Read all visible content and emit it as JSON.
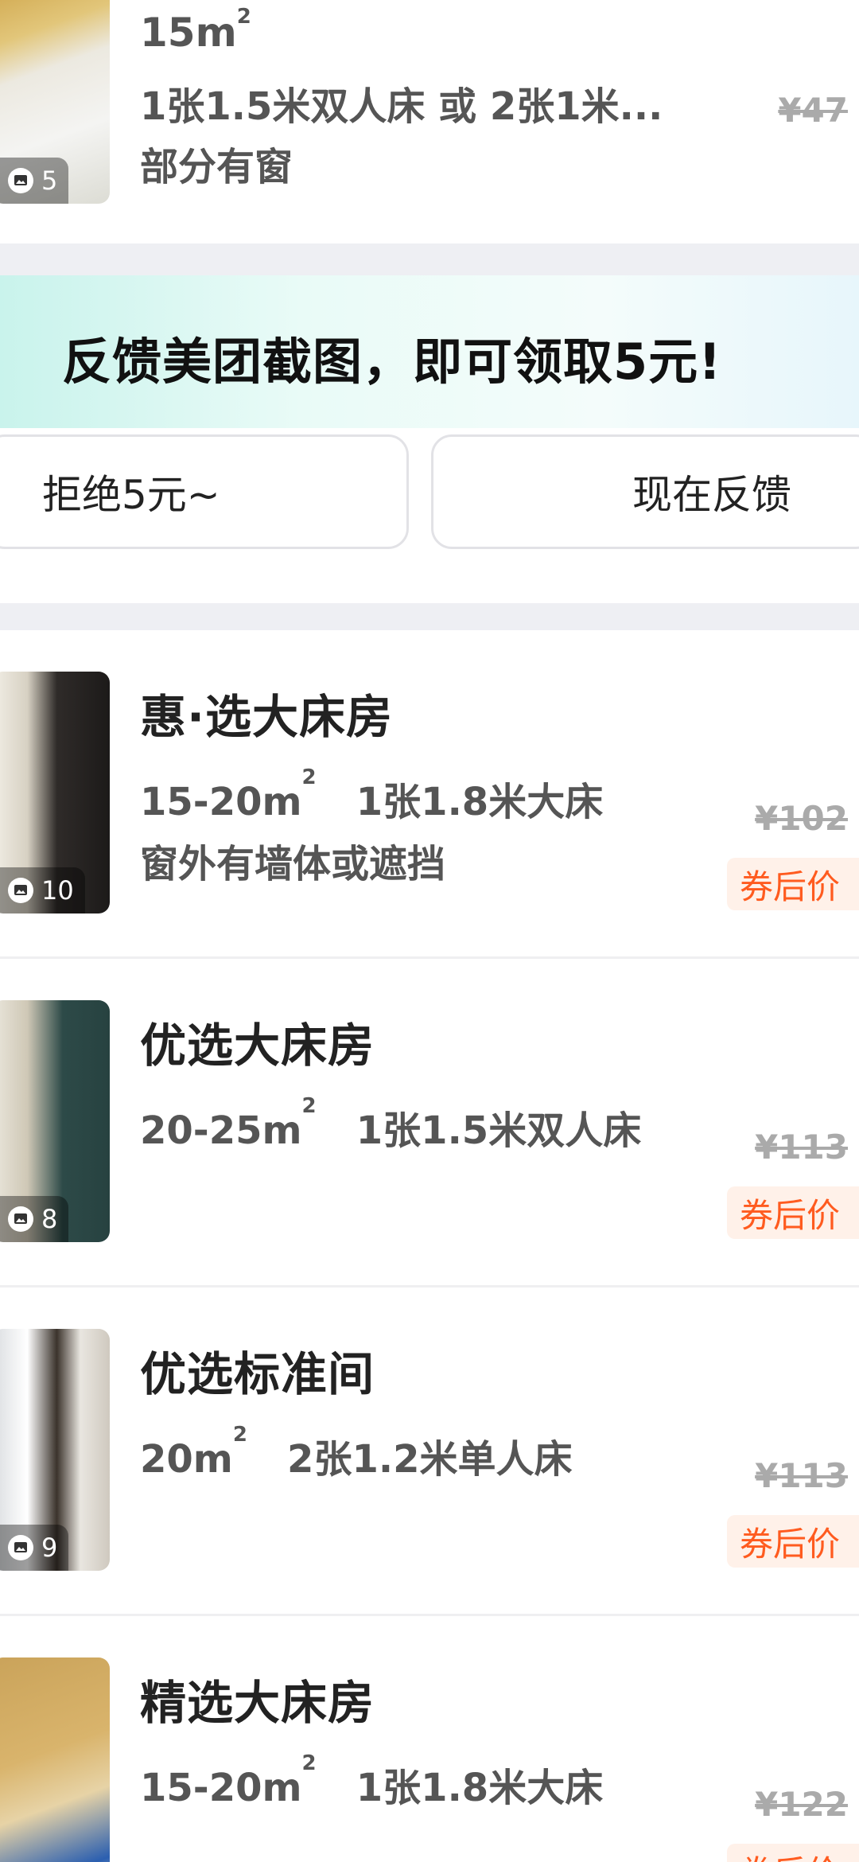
{
  "rooms": [
    {
      "title": "",
      "area": "15m",
      "area_sup": "2",
      "bed": "",
      "line2": "1张1.5米双人床 或 2张1米...",
      "line3": "部分有窗",
      "photo_count": "5",
      "old_price": "¥47",
      "coupon_label": ""
    },
    {
      "title": "惠·选大床房",
      "area": "15-20m",
      "area_sup": "2",
      "bed": "1张1.8米大床",
      "line3": "窗外有墙体或遮挡",
      "photo_count": "10",
      "old_price": "¥102",
      "coupon_label": "券后价"
    },
    {
      "title": "优选大床房",
      "area": "20-25m",
      "area_sup": "2",
      "bed": "1张1.5米双人床",
      "photo_count": "8",
      "old_price": "¥113",
      "coupon_label": "券后价"
    },
    {
      "title": "优选标准间",
      "area": "20m",
      "area_sup": "2",
      "bed": "2张1.2米单人床",
      "photo_count": "9",
      "old_price": "¥113",
      "coupon_label": "券后价"
    },
    {
      "title": "精选大床房",
      "area": "15-20m",
      "area_sup": "2",
      "bed": "1张1.8米大床",
      "photo_count": "",
      "old_price": "¥122",
      "coupon_label": "券后价"
    }
  ],
  "feedback": {
    "prompt": "反馈美团截图，即可领取5元!",
    "decline_label": "拒绝5元~",
    "accept_label": "现在反馈"
  },
  "colors": {
    "coupon_text": "#ff5b1f",
    "coupon_bg": "#fff1e9",
    "section_gap": "#eeeff3",
    "promo_gradient_start": "#c9f3ec"
  },
  "icons": {
    "photo_badge": "image-icon"
  }
}
